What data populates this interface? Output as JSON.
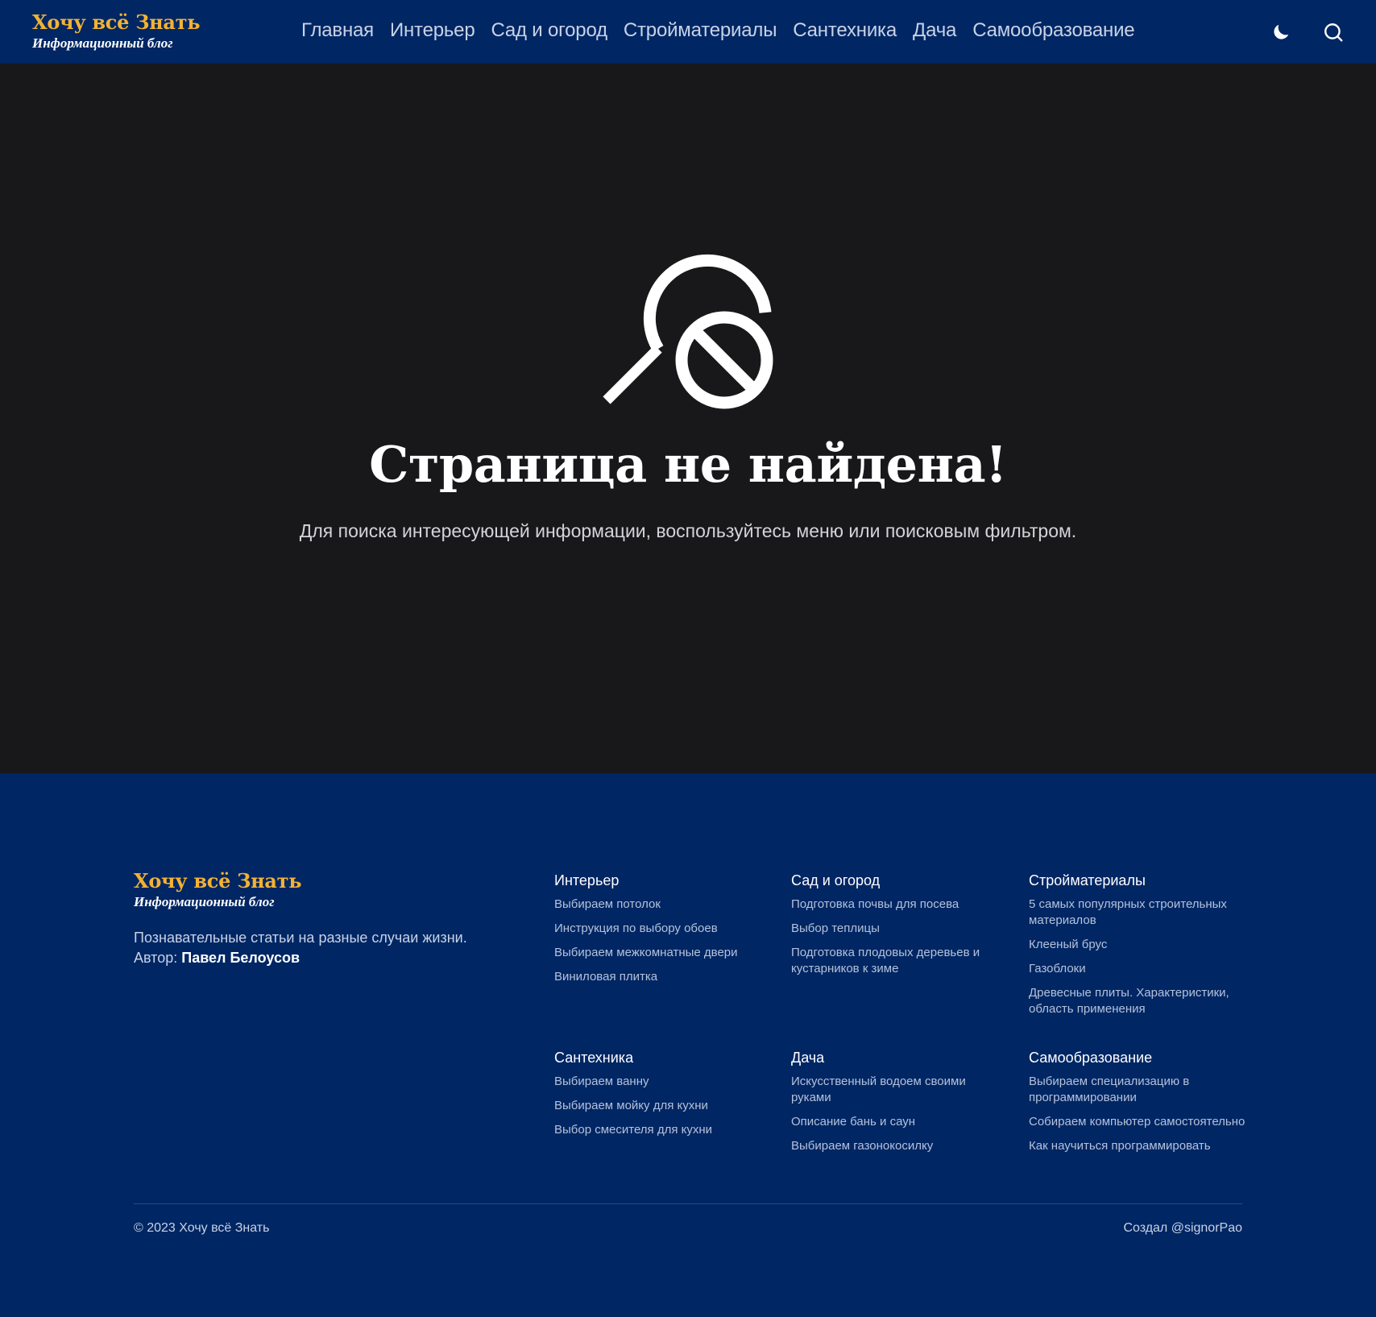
{
  "header": {
    "logo_title": "Хочу всё Знать",
    "logo_subtitle": "Информационный блог",
    "nav": [
      "Главная",
      "Интерьер",
      "Сад и огород",
      "Стройматериалы",
      "Сантехника",
      "Дача",
      "Самообразование"
    ],
    "icons": {
      "theme": "moon-icon",
      "search": "search-icon"
    }
  },
  "main": {
    "icon": "search-blocked-icon",
    "title": "Страница не найдена!",
    "text": "Для поиска интересующей информации, воспользуйтесь меню или поисковым фильтром."
  },
  "footer": {
    "logo_title": "Хочу всё Знать",
    "logo_subtitle": "Информационный блог",
    "description": "Познавательные статьи на разные случаи жизни.",
    "author_label": "Автор:",
    "author_name": "Павел Белоусов",
    "columns": [
      {
        "title": "Интерьер",
        "links": [
          "Выбираем потолок",
          "Инструкция по выбору обоев",
          "Выбираем межкомнатные двери",
          "Виниловая плитка"
        ]
      },
      {
        "title": "Сад и огород",
        "links": [
          "Подготовка почвы для посева",
          "Выбор теплицы",
          "Подготовка плодовых деревьев и кустарников к зиме"
        ]
      },
      {
        "title": "Стройматериалы",
        "links": [
          "5 самых популярных строительных материалов",
          "Клееный брус",
          "Газоблоки",
          "Древесные плиты. Характеристики, область применения"
        ]
      },
      {
        "title": "Сантехника",
        "links": [
          "Выбираем ванну",
          "Выбираем мойку для кухни",
          "Выбор смесителя для кухни"
        ]
      },
      {
        "title": "Дача",
        "links": [
          "Искусственный водоем своими руками",
          "Описание бань и саун",
          "Выбираем газонокосилку"
        ]
      },
      {
        "title": "Самообразование",
        "links": [
          "Выбираем специализацию в программировании",
          "Собираем компьютер самостоятельно",
          "Как научиться программировать"
        ]
      }
    ],
    "copyright": "© 2023 Хочу всё Знать",
    "credit": "Создал @signorPao"
  },
  "colors": {
    "header_bg": "#002664",
    "main_bg": "#18181b",
    "accent": "#f2b233"
  }
}
